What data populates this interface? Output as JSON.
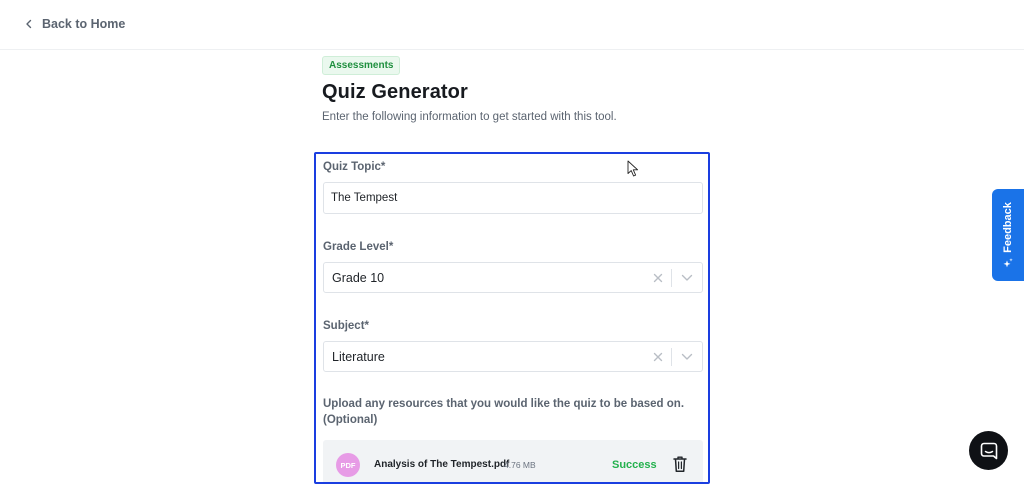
{
  "header": {
    "back_label": "Back to Home"
  },
  "tool": {
    "category_badge": "Assessments",
    "title": "Quiz Generator",
    "description": "Enter the following information to get started with this tool."
  },
  "form": {
    "quiz_topic": {
      "label": "Quiz Topic*",
      "value": "The Tempest"
    },
    "grade_level": {
      "label": "Grade Level*",
      "value": "Grade 10"
    },
    "subject": {
      "label": "Subject*",
      "value": "Literature"
    },
    "upload": {
      "label_line1": "Upload any resources that you would like the quiz to be based on.",
      "label_line2": "(Optional)",
      "file": {
        "type_label": "PDF",
        "name": "Analysis of The Tempest.pdf",
        "size": "4.76 MB",
        "status": "Success"
      }
    }
  },
  "feedback": {
    "label": "Feedback"
  },
  "colors": {
    "accent_blue": "#1a3ee0",
    "feedback_blue": "#1a73e8",
    "success_green": "#23b14d",
    "badge_green": "#1f8f3f",
    "pdf_pink": "#e79be6"
  },
  "icons": {
    "back": "chevron-left-icon",
    "clear": "close-icon",
    "dropdown": "chevron-down-icon",
    "delete": "trash-icon",
    "feedback": "sparkle-icon",
    "chat": "chat-bubble-icon",
    "cursor": "mouse-pointer-icon"
  }
}
